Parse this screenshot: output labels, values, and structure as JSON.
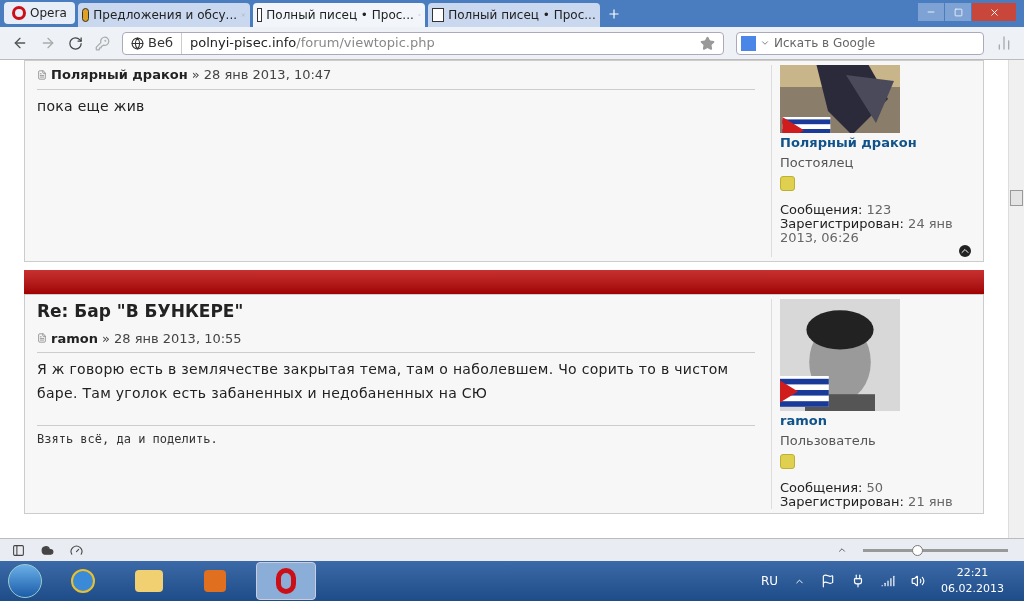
{
  "browser": {
    "menu_button": "Opera",
    "tabs": [
      {
        "title": "Предложения и обсу...",
        "selected": false
      },
      {
        "title": "Полный писец • Прос...",
        "selected": true
      },
      {
        "title": "Полный писец • Прос...",
        "selected": false
      }
    ],
    "address": {
      "badge": "Веб",
      "url_host": "polnyi-pisec.info",
      "url_path": "/forum/viewtopic.php"
    },
    "search": {
      "placeholder": "Искать в Google"
    }
  },
  "posts": [
    {
      "author": "Полярный дракон",
      "date": "» 28 янв 2013, 10:47",
      "body": "пока еще жив",
      "profile": {
        "name": "Полярный дракон",
        "rank": "Постоялец",
        "stats": [
          {
            "label": "Сообщения:",
            "value": "123"
          },
          {
            "label": "Зарегистрирован:",
            "value": "24 янв 2013, 06:26"
          }
        ]
      },
      "top_link": true
    },
    {
      "title": "Re: Бар \"В БУНКЕРЕ\"",
      "author": "ramon",
      "date": "» 28 янв 2013, 10:55",
      "body": "Я ж говорю есть в землячестве закрытая тема, там о наболевшем. Чо сорить то в чистом баре. Там уголок есть забаненных и недобаненных на СЮ",
      "signature": "Взять всё, да и поделить.",
      "profile": {
        "name": "ramon",
        "rank": "Пользователь",
        "stats": [
          {
            "label": "Сообщения:",
            "value": "50"
          },
          {
            "label": "Зарегистрирован:",
            "value": "21 янв"
          }
        ]
      }
    }
  ],
  "status_bar": {
    "zoom": {
      "level": 0.37
    }
  },
  "taskbar": {
    "language": "RU",
    "time": "22:21",
    "date": "06.02.2013"
  }
}
